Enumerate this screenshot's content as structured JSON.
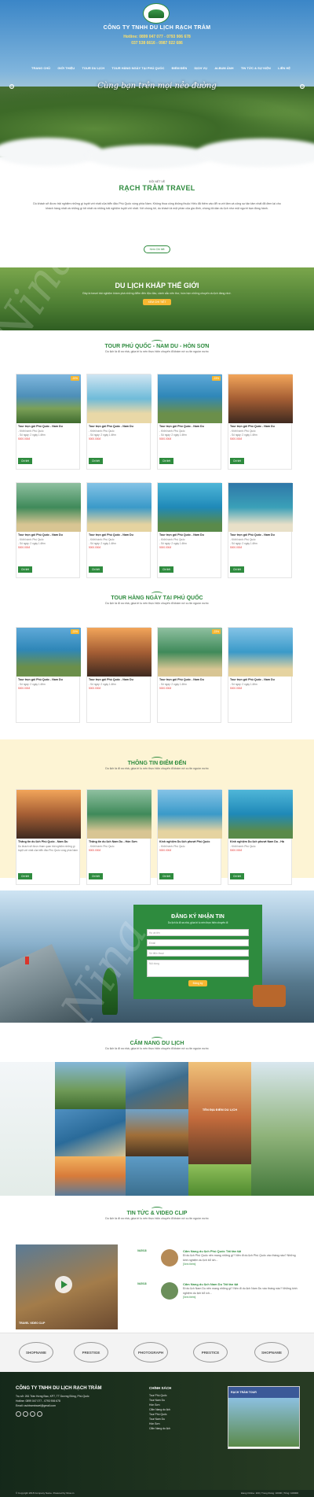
{
  "header": {
    "company": "CÔNG TY TNHH DU LỊCH RẠCH TRÀM",
    "hotline_label": "Hotline:",
    "hotline_1": "0899 047 077 - 0793 906 678",
    "hotline_2": "037 538 6616 - 0987 022 686",
    "nav": [
      "TRANG CHỦ",
      "GIỚI THIỆU",
      "TOUR DU LỊCH",
      "TOUR HẰNG NGÀY TẠI PHÚ QUỐC",
      "ĐIỂM ĐẾN",
      "DỊCH VỤ",
      "ALBUM ẢNH",
      "TIN TỨC & SỰ KIỆN",
      "LIÊN HỆ"
    ],
    "slogan": "Cùng bạn trên mọi nẻo đường"
  },
  "intro": {
    "kicker": "ĐÔI NÉT VỀ",
    "title": "RẠCH TRÀM TRAVEL",
    "text": "Dù khách sẽ được trải nghiệm những gì tuyệt vời nhất của biển đảo Phú Quốc vùng phía Nam. Không thua công không thuộc Hiếu đã thêm vào để ra với tâm và công sự tận tâm nhất đã đem lại cho khách hàng nhất và những gì tốt nhất và những trải nghiệm tuyệt vời nhất. Với chúng tôi, du khách là một phần của gia đình, chúng tôi dần du lịch như một người bạn đồng hành.",
    "button": "Xem Chi tiết"
  },
  "world": {
    "title": "DU LỊCH KHẮP THẾ GIỚI",
    "text": "Đây là travel trải nghiệm khám phá những điểm đến độc đáo, cảnh sắc nên thơ, hứa hẹn những chuyến du lịch đáng nhớ.",
    "button": "XEM CHI TIẾT"
  },
  "tour1": {
    "title": "TOUR PHÚ QUỐC - NAM DU - HÒN SƠN",
    "subtitle": "Du lịch là đi xa nhà, giúa tri lu nén thực hiện chuyến đi khám nớ cu tin nguồn nước",
    "cards": [
      {
        "title": "Tour trọn gói Phú Quốc - Nam Du",
        "l1": "- Khởi hành: Phú Quốc",
        "l2": "- Số ngày: 2 ngày 1 đêm",
        "price": "5000.000đ",
        "sale": "-23%",
        "btn": "Chi tiết"
      },
      {
        "title": "Tour trọn gói Phú Quốc - Nam Du",
        "l1": "- Khởi hành: Phú Quốc",
        "l2": "- Số ngày: 2 ngày 1 đêm",
        "price": "5000.000đ",
        "sale": "",
        "btn": "Chi tiết"
      },
      {
        "title": "Tour trọn gói Phú Quốc - Nam Du",
        "l1": "- Khởi hành: Phú Quốc",
        "l2": "- Số ngày: 2 ngày 1 đêm",
        "price": "5000.000đ",
        "sale": "-23%",
        "btn": "Chi tiết"
      },
      {
        "title": "Tour trọn gói Phú Quốc - Nam Du",
        "l1": "- Khởi hành: Phú Quốc",
        "l2": "- Số ngày: 2 ngày 1 đêm",
        "price": "5000.000đ",
        "sale": "",
        "btn": "Chi tiết"
      },
      {
        "title": "Tour trọn gói Phú Quốc - Nam Du",
        "l1": "- Khởi hành: Phú Quốc",
        "l2": "- Số ngày: 2 ngày 1 đêm",
        "price": "5000.000đ",
        "sale": "",
        "btn": "Chi tiết"
      },
      {
        "title": "Tour trọn gói Phú Quốc - Nam Du",
        "l1": "- Khởi hành: Phú Quốc",
        "l2": "- Số ngày: 2 ngày 1 đêm",
        "price": "5000.000đ",
        "sale": "",
        "btn": "Chi tiết"
      },
      {
        "title": "Tour trọn gói Phú Quốc - Nam Du",
        "l1": "- Khởi hành: Phú Quốc",
        "l2": "- Số ngày: 2 ngày 1 đêm",
        "price": "5000.000đ",
        "sale": "",
        "btn": "Chi tiết"
      },
      {
        "title": "Tour trọn gói Phú Quốc - Nam Du",
        "l1": "- Khởi hành: Phú Quốc",
        "l2": "- Số ngày: 2 ngày 1 đêm",
        "price": "5000.000đ",
        "sale": "",
        "btn": "Chi tiết"
      }
    ]
  },
  "tour2": {
    "title": "TOUR HẰNG NGÀY TẠI PHÚ QUỐC",
    "subtitle": "Du lịch là đi xa nhà, giúa tri lu nén thực hiện chuyến đi khám nớ cu tin nguồn nước",
    "cards": [
      {
        "title": "Tour trọn gói Phú Quốc - Nam Du",
        "l1": "- Số ngày: 2 ngày 1 đêm",
        "price": "5000.000đ",
        "sale": "-23%"
      },
      {
        "title": "Tour trọn gói Phú Quốc - Nam Du",
        "l1": "- Số ngày: 2 ngày 1 đêm",
        "price": "5000.000đ",
        "sale": ""
      },
      {
        "title": "Tour trọn gói Phú Quốc - Nam Du",
        "l1": "- Số ngày: 2 ngày 1 đêm",
        "price": "5000.000đ",
        "sale": "-23%"
      },
      {
        "title": "Tour trọn gói Phú Quốc - Nam Du",
        "l1": "- Số ngày: 2 ngày 1 đêm",
        "price": "5000.000đ",
        "sale": ""
      }
    ]
  },
  "dest": {
    "title": "THÔNG TIN ĐIỂM ĐẾN",
    "subtitle": "Du lịch là đi xa nhà, giúa tri lu nén thực hiện chuyến đi khám nớ cu tin nguồn nước",
    "cards": [
      {
        "title": "Thăng tin du lịch Phú Quốc - Nam Du",
        "l1": "Du khách sẽ được tham quan trải nghiệm những gì tuyệt vời nhất của biển đảo Phú Quốc vùng phía Nam"
      },
      {
        "title": "Thăng tin du lịch Nam Du - Hòn Sơn",
        "l1": "- Khởi hành: Phú Quốc",
        "price": "5000.000đ"
      },
      {
        "title": "Kinh nghiệm Du lịch phượt Phú Quốc",
        "l1": "- Khởi hành: Phú Quốc",
        "price": "5000.000đ"
      },
      {
        "title": "Kinh nghiệm Du lịch phượt Nam Du - Hà",
        "l1": "- Khởi hành: Phú Quốc",
        "price": "5000.000đ"
      }
    ],
    "btn": "Chi tiết"
  },
  "register": {
    "title": "ĐĂNG KÝ NHẬN TIN",
    "subtitle": "Du lịch là đi xa nhà, giúa tri lu nén thực hiện chuyến đi",
    "fields": [
      "Họ và tên",
      "Email",
      "Số điện thoại",
      "Nội dung"
    ],
    "button": "Đăng ký"
  },
  "handbook": {
    "title": "CẨM NANG DU LỊCH",
    "subtitle": "Du lịch là đi xa nhà, giúa tri lu nén thực hiện chuyến đi khám nớ cu tin nguồn nước",
    "feature": "TÊN ĐỊA ĐIỂM DU LỊCH"
  },
  "news": {
    "title": "TIN TỨC & VIDEO CLIP",
    "subtitle": "Du lịch là đi xa nhà, giúa tri lu nén thực hiện chuyến đi khám nớ cu tin nguồn nước",
    "video_caption": "TRAVEL VIDEO CLIP",
    "items": [
      {
        "date": "04/2018",
        "title": "Cẩm Nang du lịch Phú Quốc Tất tần tật",
        "text": "Đi du lịch Phú Quốc nên mang những gì? Nên đi du lịch Phú Quốc vào tháng nào? Những kinh nghiệm du lịch bổ ích..."
      },
      {
        "date": "04/2018",
        "title": "Cẩm Nang du lịch Nam Du Tất tần tật",
        "text": "Đi du lịch Nam Du nên mang những gì? Nên đi du lịch Nam Du vào tháng nào? Những kinh nghiệm du lịch bổ ích..."
      }
    ],
    "more": "[Xem thêm]"
  },
  "brands": [
    "SHOPNAME",
    "PRESTIGE",
    "PHOTOGRAPH",
    "PRESTICE",
    "SHOPNAME"
  ],
  "footer": {
    "company": "CÔNG TY TNHH DU LỊCH RẠCH TRÀM",
    "lines": [
      "Trụ sở: 261 Trần Hưng Đạo, KP7, TT Dương Đông, Phú Quốc",
      "Hotline: 0899 047 077 - 0793 906 678",
      "Email: rachtramtravel@gmail.com"
    ],
    "policy_title": "CHÍNH SÁCH",
    "policy": [
      "Tour Phú Quốc",
      "Tour Nam Du",
      "Hòn Sơn",
      "Cẩm Nang du lịch",
      "Tour Phú Quốc",
      "Tour Nam Du",
      "Hòn Sơn",
      "Cẩm Nang du lịch"
    ],
    "fb_title": "RẠCH TRÀM TOUR",
    "copyright": "© Copyright 2018 Company Name. Powered by Nina.vn",
    "stats": "Đang Online: 100 | Trong tháng: 10000 | Tổng: 100000"
  },
  "colors": {
    "accent": "#2e8b3e",
    "price": "#e53935",
    "sale": "#f7b731"
  }
}
